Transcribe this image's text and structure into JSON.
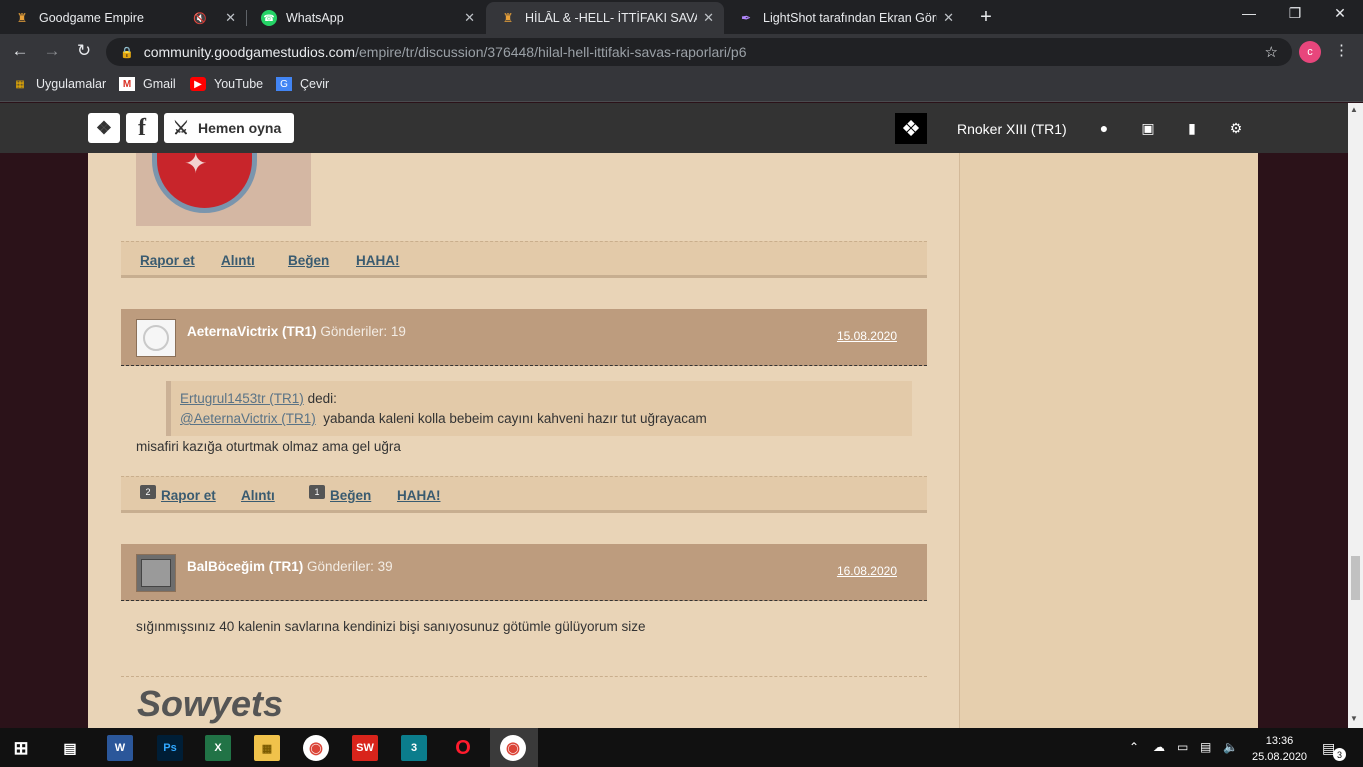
{
  "browser": {
    "tabs": [
      {
        "label": "Goodgame Empire",
        "icon": "goodgame-icon",
        "muted": true
      },
      {
        "label": "WhatsApp",
        "icon": "whatsapp-icon"
      },
      {
        "label": "HİLÂL & -HELL- İTTİFAKI SAVAŞ R",
        "icon": "goodgame-icon"
      },
      {
        "label": "LightShot tarafından Ekran Görün",
        "icon": "lightshot-icon"
      }
    ],
    "url_host": "community.goodgamestudios.com",
    "url_path": "/empire/tr/discussion/376448/hilal-hell-ittifaki-savas-raporlari/p6",
    "profile_initial": "c",
    "bookmarks": [
      "Uygulamalar",
      "Gmail",
      "YouTube",
      "Çevir"
    ]
  },
  "site": {
    "play_label": "Hemen oyna",
    "username": "Rnoker XIII (TR1)"
  },
  "posts": [
    {
      "actions": [
        "Rapor et",
        "Alıntı",
        "Beğen",
        "HAHA!"
      ]
    },
    {
      "author": "AeternaVictrix (TR1)",
      "count_label": "Gönderiler: 19",
      "date": "15.08.2020",
      "quote_author": "Ertugrul1453tr (TR1)",
      "quote_said": "dedi:",
      "quote_mention": "@AeternaVictrix (TR1)",
      "quote_text": "yabanda kaleni kolla bebeim cayını kahveni hazır tut uğrayacam",
      "body": "misafiri kazığa oturtmak olmaz ama gel uğra",
      "actions": [
        "Rapor et",
        "Alıntı",
        "Beğen",
        "HAHA!"
      ],
      "report_count": "2",
      "like_count": "1"
    },
    {
      "author": "BalBöceğim (TR1)",
      "count_label": "Gönderiler: 39",
      "date": "16.08.2020",
      "body": "sığınmışsınız 40 kalenin savlarına kendinizi bişi sanıyosunuz götümle gülüyorum size",
      "signature": "Sowyets"
    }
  ],
  "taskbar": {
    "time": "13:36",
    "date": "25.08.2020",
    "notifications": "3"
  }
}
